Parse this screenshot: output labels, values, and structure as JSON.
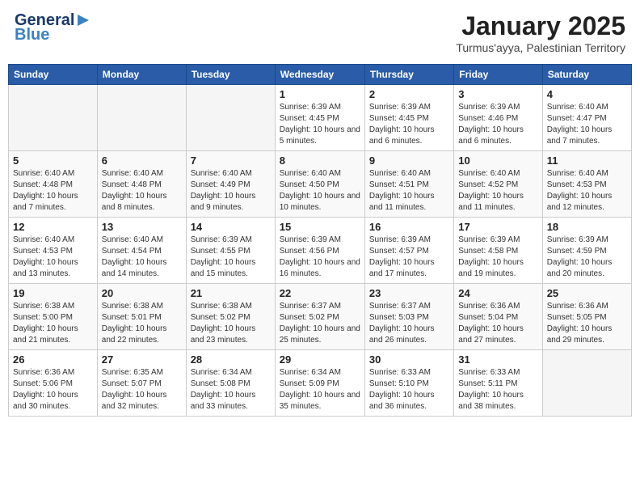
{
  "header": {
    "logo_general": "General",
    "logo_blue": "Blue",
    "month": "January 2025",
    "location": "Turmus'ayya, Palestinian Territory"
  },
  "weekdays": [
    "Sunday",
    "Monday",
    "Tuesday",
    "Wednesday",
    "Thursday",
    "Friday",
    "Saturday"
  ],
  "weeks": [
    [
      {
        "day": "",
        "info": ""
      },
      {
        "day": "",
        "info": ""
      },
      {
        "day": "",
        "info": ""
      },
      {
        "day": "1",
        "info": "Sunrise: 6:39 AM\nSunset: 4:45 PM\nDaylight: 10 hours and 5 minutes."
      },
      {
        "day": "2",
        "info": "Sunrise: 6:39 AM\nSunset: 4:45 PM\nDaylight: 10 hours and 6 minutes."
      },
      {
        "day": "3",
        "info": "Sunrise: 6:39 AM\nSunset: 4:46 PM\nDaylight: 10 hours and 6 minutes."
      },
      {
        "day": "4",
        "info": "Sunrise: 6:40 AM\nSunset: 4:47 PM\nDaylight: 10 hours and 7 minutes."
      }
    ],
    [
      {
        "day": "5",
        "info": "Sunrise: 6:40 AM\nSunset: 4:48 PM\nDaylight: 10 hours and 7 minutes."
      },
      {
        "day": "6",
        "info": "Sunrise: 6:40 AM\nSunset: 4:48 PM\nDaylight: 10 hours and 8 minutes."
      },
      {
        "day": "7",
        "info": "Sunrise: 6:40 AM\nSunset: 4:49 PM\nDaylight: 10 hours and 9 minutes."
      },
      {
        "day": "8",
        "info": "Sunrise: 6:40 AM\nSunset: 4:50 PM\nDaylight: 10 hours and 10 minutes."
      },
      {
        "day": "9",
        "info": "Sunrise: 6:40 AM\nSunset: 4:51 PM\nDaylight: 10 hours and 11 minutes."
      },
      {
        "day": "10",
        "info": "Sunrise: 6:40 AM\nSunset: 4:52 PM\nDaylight: 10 hours and 11 minutes."
      },
      {
        "day": "11",
        "info": "Sunrise: 6:40 AM\nSunset: 4:53 PM\nDaylight: 10 hours and 12 minutes."
      }
    ],
    [
      {
        "day": "12",
        "info": "Sunrise: 6:40 AM\nSunset: 4:53 PM\nDaylight: 10 hours and 13 minutes."
      },
      {
        "day": "13",
        "info": "Sunrise: 6:40 AM\nSunset: 4:54 PM\nDaylight: 10 hours and 14 minutes."
      },
      {
        "day": "14",
        "info": "Sunrise: 6:39 AM\nSunset: 4:55 PM\nDaylight: 10 hours and 15 minutes."
      },
      {
        "day": "15",
        "info": "Sunrise: 6:39 AM\nSunset: 4:56 PM\nDaylight: 10 hours and 16 minutes."
      },
      {
        "day": "16",
        "info": "Sunrise: 6:39 AM\nSunset: 4:57 PM\nDaylight: 10 hours and 17 minutes."
      },
      {
        "day": "17",
        "info": "Sunrise: 6:39 AM\nSunset: 4:58 PM\nDaylight: 10 hours and 19 minutes."
      },
      {
        "day": "18",
        "info": "Sunrise: 6:39 AM\nSunset: 4:59 PM\nDaylight: 10 hours and 20 minutes."
      }
    ],
    [
      {
        "day": "19",
        "info": "Sunrise: 6:38 AM\nSunset: 5:00 PM\nDaylight: 10 hours and 21 minutes."
      },
      {
        "day": "20",
        "info": "Sunrise: 6:38 AM\nSunset: 5:01 PM\nDaylight: 10 hours and 22 minutes."
      },
      {
        "day": "21",
        "info": "Sunrise: 6:38 AM\nSunset: 5:02 PM\nDaylight: 10 hours and 23 minutes."
      },
      {
        "day": "22",
        "info": "Sunrise: 6:37 AM\nSunset: 5:02 PM\nDaylight: 10 hours and 25 minutes."
      },
      {
        "day": "23",
        "info": "Sunrise: 6:37 AM\nSunset: 5:03 PM\nDaylight: 10 hours and 26 minutes."
      },
      {
        "day": "24",
        "info": "Sunrise: 6:36 AM\nSunset: 5:04 PM\nDaylight: 10 hours and 27 minutes."
      },
      {
        "day": "25",
        "info": "Sunrise: 6:36 AM\nSunset: 5:05 PM\nDaylight: 10 hours and 29 minutes."
      }
    ],
    [
      {
        "day": "26",
        "info": "Sunrise: 6:36 AM\nSunset: 5:06 PM\nDaylight: 10 hours and 30 minutes."
      },
      {
        "day": "27",
        "info": "Sunrise: 6:35 AM\nSunset: 5:07 PM\nDaylight: 10 hours and 32 minutes."
      },
      {
        "day": "28",
        "info": "Sunrise: 6:34 AM\nSunset: 5:08 PM\nDaylight: 10 hours and 33 minutes."
      },
      {
        "day": "29",
        "info": "Sunrise: 6:34 AM\nSunset: 5:09 PM\nDaylight: 10 hours and 35 minutes."
      },
      {
        "day": "30",
        "info": "Sunrise: 6:33 AM\nSunset: 5:10 PM\nDaylight: 10 hours and 36 minutes."
      },
      {
        "day": "31",
        "info": "Sunrise: 6:33 AM\nSunset: 5:11 PM\nDaylight: 10 hours and 38 minutes."
      },
      {
        "day": "",
        "info": ""
      }
    ]
  ]
}
